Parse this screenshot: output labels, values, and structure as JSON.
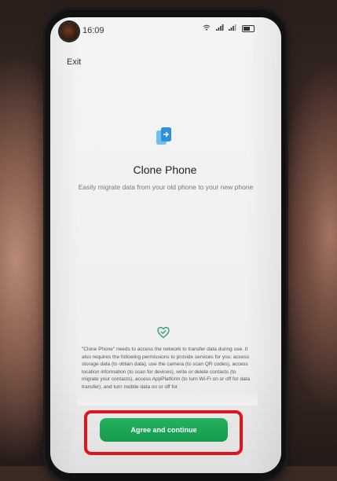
{
  "status_bar": {
    "time": "16:09",
    "icons": [
      "wifi-icon",
      "signal-icon",
      "signal-icon",
      "battery-icon"
    ]
  },
  "nav": {
    "exit_label": "Exit"
  },
  "app": {
    "icon": "clone-phone-icon",
    "title": "Clone Phone",
    "subtitle": "Easily migrate data from your old phone to your new phone"
  },
  "privacy": {
    "icon": "privacy-shield-icon",
    "notice": "\"Clone Phone\" needs to access the network to transfer data during use. It also requires the following permissions to provide services for you: access storage data (to obtain data), use the camera (to scan QR codes), access location information (to scan for devices), write or delete contacts (to migrate your contacts), access AppPlatform (to turn Wi-Fi on or off for data transfer), and turn mobile data on or off for"
  },
  "actions": {
    "agree_label": "Agree and continue",
    "agree_color": "#1aa653",
    "highlight_color": "#e0141b"
  }
}
